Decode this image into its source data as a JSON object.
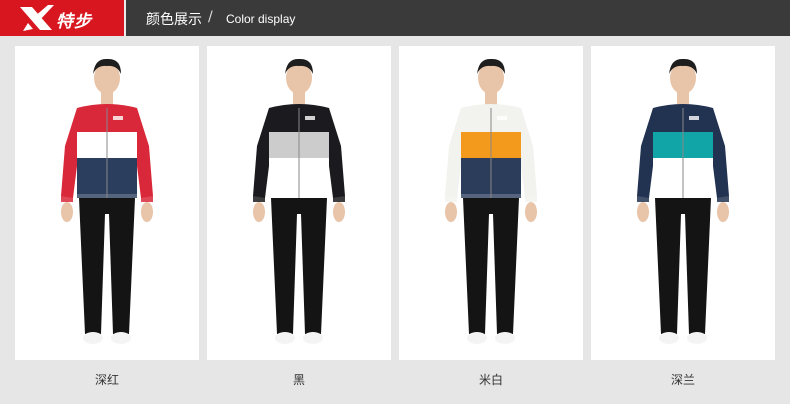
{
  "brand": {
    "name": "特步",
    "logo_icon": "xtep-x-logo"
  },
  "header": {
    "title": "颜色展示",
    "slash": "/",
    "subtitle": "Color display"
  },
  "products": [
    {
      "label": "深红",
      "top": "#d9283a",
      "middle": "#ffffff",
      "bottom": "#2c3e5e",
      "sleeve": "#d9283a",
      "hood": "#d9283a"
    },
    {
      "label": "黑",
      "top": "#1b1b1f",
      "middle": "#cccccc",
      "bottom": "#ffffff",
      "sleeve": "#1b1b1f",
      "hood": "#1b1b1f"
    },
    {
      "label": "米白",
      "top": "#f2f2ee",
      "middle": "#f39a1c",
      "bottom": "#2c3d5c",
      "sleeve": "#f2f2ee",
      "hood": "#f2f2ee"
    },
    {
      "label": "深兰",
      "top": "#223251",
      "middle": "#12a5a8",
      "bottom": "#ffffff",
      "sleeve": "#223251",
      "hood": "#223251"
    }
  ]
}
